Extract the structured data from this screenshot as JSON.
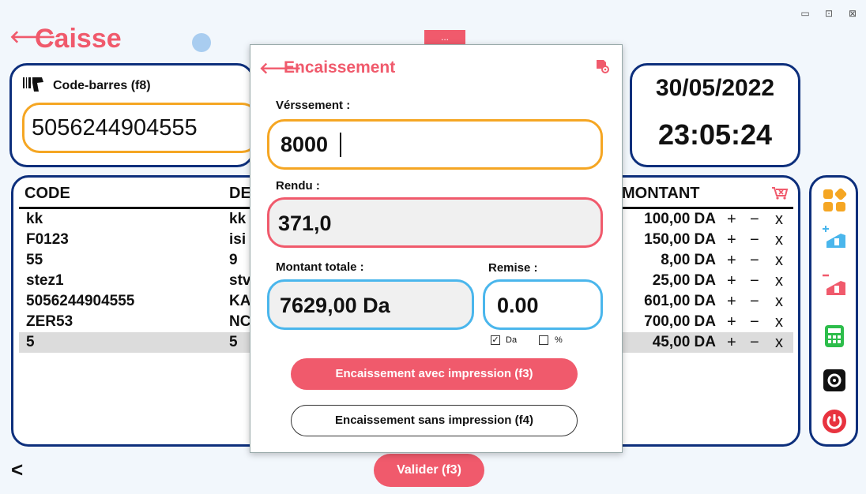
{
  "window": {
    "minimize": "▭",
    "maximize": "⊡",
    "close": "⊠"
  },
  "header": {
    "back_icon": "🡐",
    "title": "Caisse",
    "menu_label": "..."
  },
  "barcode": {
    "label": "Code-barres (f8)",
    "value": "5056244904555",
    "icon": "barcode-scanner-icon"
  },
  "clock": {
    "date": "30/05/2022",
    "time": "23:05:24"
  },
  "table": {
    "headers": {
      "code": "CODE",
      "designation": "DE",
      "montant": "MONTANT"
    },
    "rows": [
      {
        "code": "kk",
        "designation": "kk",
        "montant": "100,00 DA"
      },
      {
        "code": "F0123",
        "designation": "isi",
        "montant": "150,00 DA"
      },
      {
        "code": "55",
        "designation": "9",
        "montant": "8,00 DA"
      },
      {
        "code": "stez1",
        "designation": "stv",
        "montant": "25,00 DA"
      },
      {
        "code": "5056244904555",
        "designation": "KA",
        "montant": "601,00 DA"
      },
      {
        "code": "ZER53",
        "designation": "NC",
        "montant": "700,00 DA"
      },
      {
        "code": "5",
        "designation": "5",
        "montant": "45,00 DA"
      }
    ],
    "row_actions": {
      "plus": "+",
      "minus": "−",
      "remove": "x"
    }
  },
  "footer": {
    "back": "<",
    "valider": "Valider (f3)"
  },
  "modal": {
    "back_icon": "🡐",
    "title": "Encaissement",
    "versement_label": "Vérssement :",
    "versement_value": "8000",
    "rendu_label": "Rendu :",
    "rendu_value": "371,0",
    "total_label": "Montant totale :",
    "total_value": "7629,00 Da",
    "remise_label": "Remise :",
    "remise_value": "0.00",
    "da_label": "Da",
    "pct_label": "%",
    "da_checked": true,
    "pct_checked": false,
    "btn_with_print": "Encaissement avec impression (f3)",
    "btn_without_print": "Encaissement sans impression (f4)"
  },
  "colors": {
    "accent": "#f05a6c",
    "navy": "#0d2f7c",
    "orange": "#f5a623",
    "blue": "#4ab6ec"
  }
}
